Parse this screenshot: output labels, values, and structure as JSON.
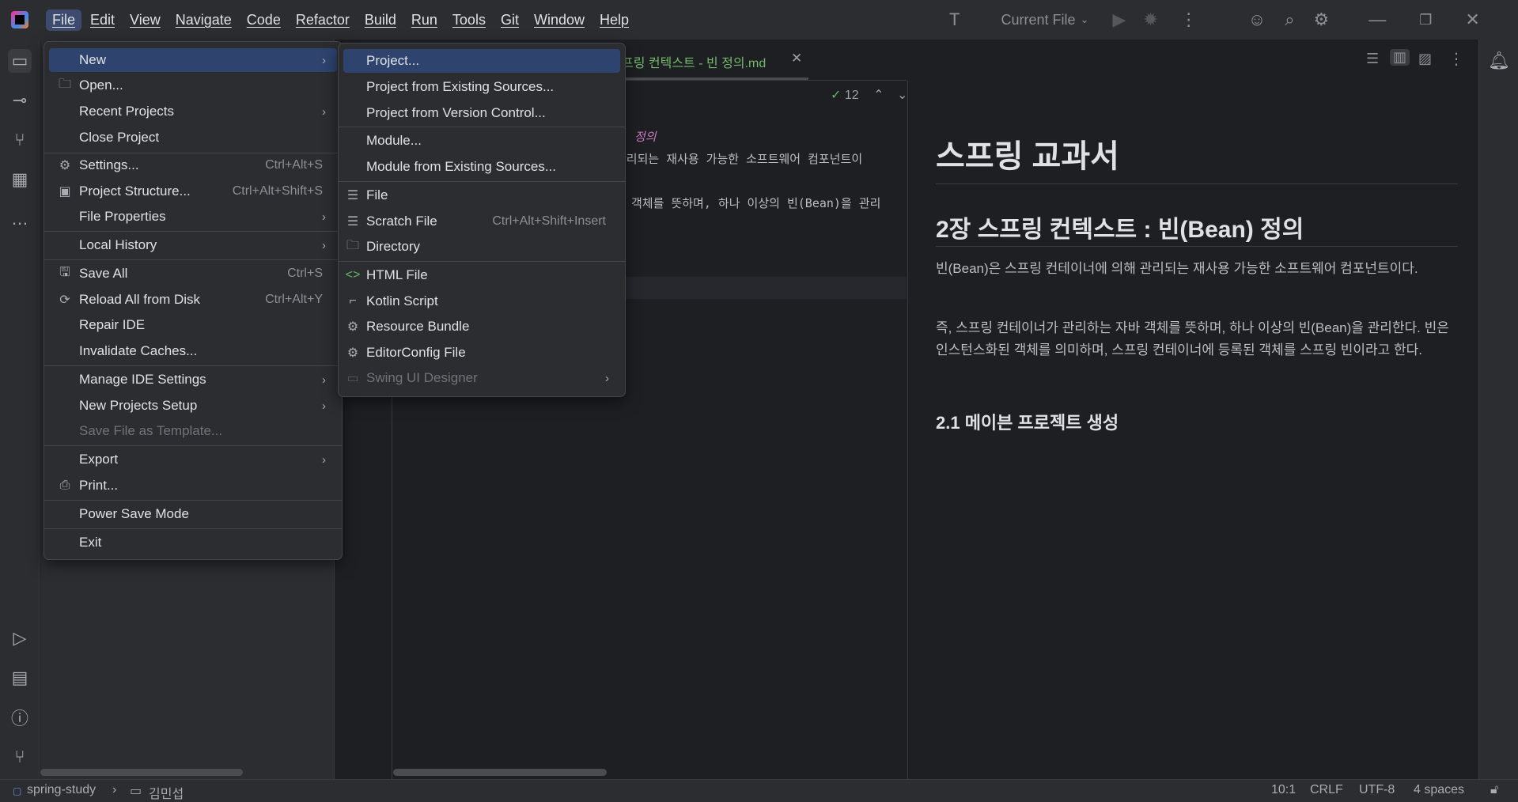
{
  "menubar": {
    "items": [
      "File",
      "Edit",
      "View",
      "Navigate",
      "Code",
      "Refactor",
      "Build",
      "Run",
      "Tools",
      "Git",
      "Window",
      "Help"
    ]
  },
  "toolbar": {
    "run_config": "Current File"
  },
  "editor": {
    "tab_label": "프링 컨텍스트 - 빈 정의.md",
    "inspection_count": "12",
    "lines": {
      "l1": "정의",
      "l2": "관리되는  재사용  가능한  소프트웨어  컴포넌트이",
      "l3": "객체를 뜻하며, 하나 이상의 빈(Bean)을 관리"
    }
  },
  "preview": {
    "h1": "스프링 교과서",
    "h2": "2장 스프링 컨텍스트 : 빈(Bean) 정의",
    "p1": "빈(Bean)은 스프링 컨테이너에 의해 관리되는 재사용 가능한 소프트웨어 컴포넌트이다.",
    "p2": "즉, 스프링 컨테이너가 관리하는 자바 객체를 뜻하며, 하나 이상의 빈(Bean)을 관리한다. 빈은 인스턴스화된 객체를 의미하며, 스프링 컨테이너에 등록된 객체를 스프링 빈이라고 한다.",
    "h3": "2.1 메이븐 프로젝트 생성"
  },
  "file_menu": {
    "items": [
      {
        "label": "New",
        "shortcut": "",
        "arrow": "›"
      },
      {
        "label": "Open...",
        "shortcut": "",
        "arrow": ""
      },
      {
        "label": "Recent Projects",
        "shortcut": "",
        "arrow": "›"
      },
      {
        "label": "Close Project",
        "shortcut": "",
        "arrow": ""
      },
      {
        "label": "Settings...",
        "shortcut": "Ctrl+Alt+S",
        "arrow": ""
      },
      {
        "label": "Project Structure...",
        "shortcut": "Ctrl+Alt+Shift+S",
        "arrow": ""
      },
      {
        "label": "File Properties",
        "shortcut": "",
        "arrow": "›"
      },
      {
        "label": "Local History",
        "shortcut": "",
        "arrow": "›"
      },
      {
        "label": "Save All",
        "shortcut": "Ctrl+S",
        "arrow": ""
      },
      {
        "label": "Reload All from Disk",
        "shortcut": "Ctrl+Alt+Y",
        "arrow": ""
      },
      {
        "label": "Repair IDE",
        "shortcut": "",
        "arrow": ""
      },
      {
        "label": "Invalidate Caches...",
        "shortcut": "",
        "arrow": ""
      },
      {
        "label": "Manage IDE Settings",
        "shortcut": "",
        "arrow": "›"
      },
      {
        "label": "New Projects Setup",
        "shortcut": "",
        "arrow": "›"
      },
      {
        "label": "Save File as Template...",
        "shortcut": "",
        "arrow": ""
      },
      {
        "label": "Export",
        "shortcut": "",
        "arrow": "›"
      },
      {
        "label": "Print...",
        "shortcut": "",
        "arrow": ""
      },
      {
        "label": "Power Save Mode",
        "shortcut": "",
        "arrow": ""
      },
      {
        "label": "Exit",
        "shortcut": "",
        "arrow": ""
      }
    ]
  },
  "new_menu": {
    "items": [
      {
        "label": "Project...",
        "shortcut": ""
      },
      {
        "label": "Project from Existing Sources...",
        "shortcut": ""
      },
      {
        "label": "Project from Version Control...",
        "shortcut": ""
      },
      {
        "label": "Module...",
        "shortcut": ""
      },
      {
        "label": "Module from Existing Sources...",
        "shortcut": ""
      },
      {
        "label": "File",
        "shortcut": ""
      },
      {
        "label": "Scratch File",
        "shortcut": "Ctrl+Alt+Shift+Insert"
      },
      {
        "label": "Directory",
        "shortcut": ""
      },
      {
        "label": "HTML File",
        "shortcut": ""
      },
      {
        "label": "Kotlin Script",
        "shortcut": ""
      },
      {
        "label": "Resource Bundle",
        "shortcut": ""
      },
      {
        "label": "EditorConfig File",
        "shortcut": ""
      },
      {
        "label": "Swing UI Designer",
        "shortcut": "",
        "arrow": "›"
      }
    ]
  },
  "statusbar": {
    "project": "spring-study",
    "folder": "김민섭",
    "position": "10:1",
    "line_ending": "CRLF",
    "encoding": "UTF-8",
    "indent": "4 spaces"
  }
}
